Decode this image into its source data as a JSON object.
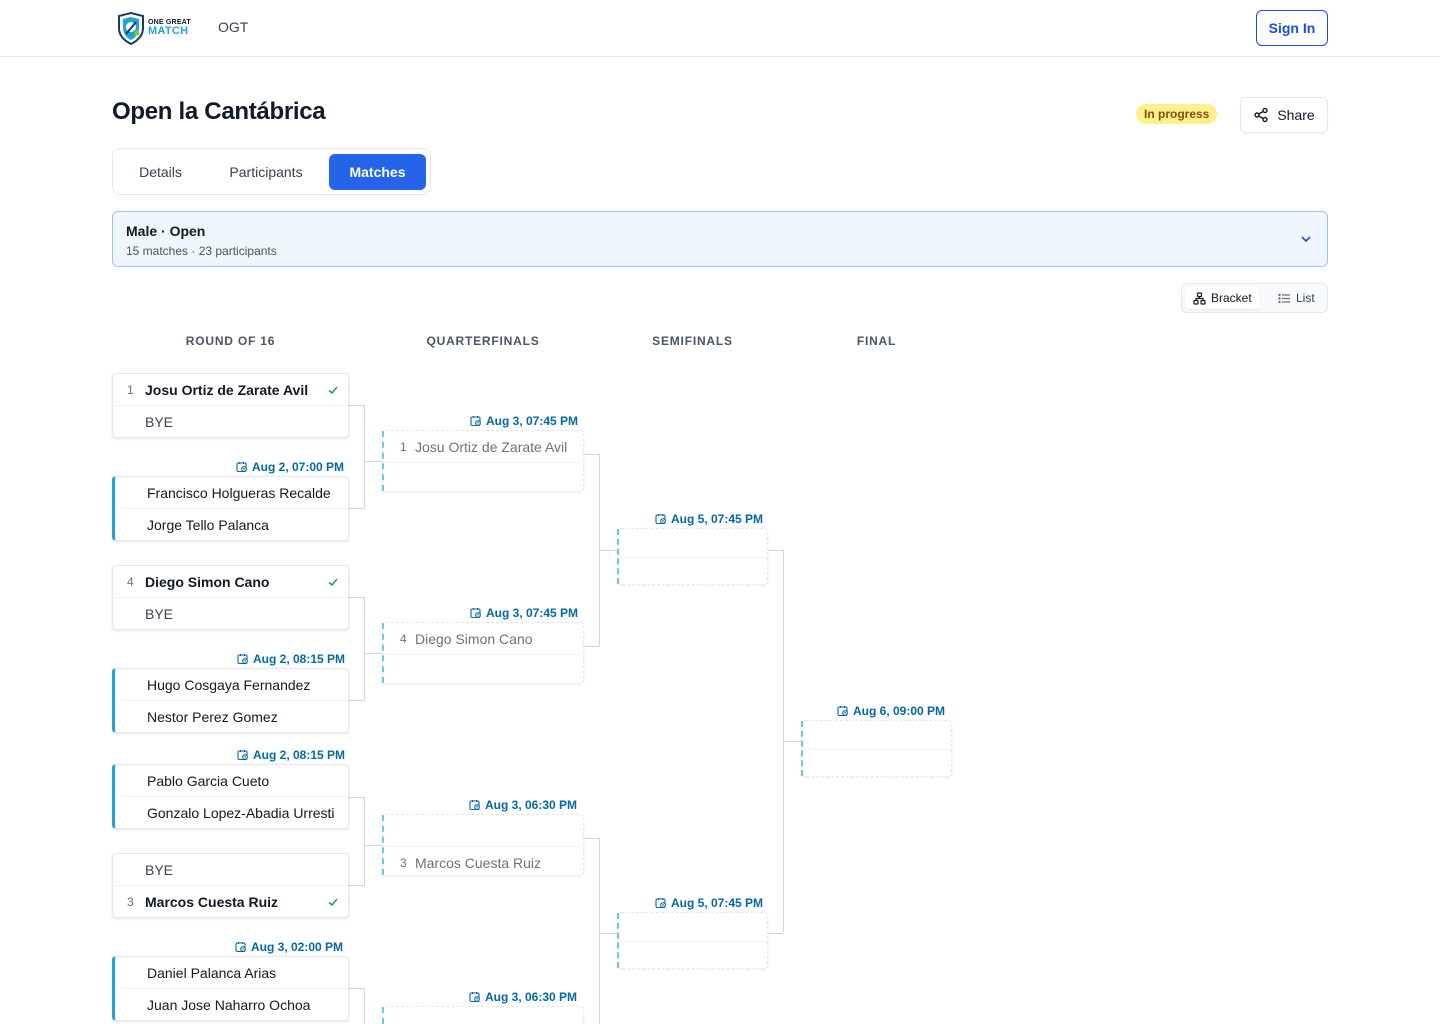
{
  "header": {
    "logo_line1": "ONE GREAT",
    "logo_line2": "MATCH",
    "nav_item": "OGT",
    "signin_label": "Sign In"
  },
  "tournament": {
    "title": "Open la Cantábrica",
    "status": "In progress",
    "share_label": "Share"
  },
  "tabs": [
    {
      "label": "Details",
      "active": false
    },
    {
      "label": "Participants",
      "active": false
    },
    {
      "label": "Matches",
      "active": true
    }
  ],
  "category": {
    "title": "Male · Open",
    "subtitle": "15 matches · 23 participants"
  },
  "view_toggle": {
    "bracket_label": "Bracket",
    "list_label": "List",
    "selected": "Bracket"
  },
  "rounds": [
    "ROUND OF 16",
    "QUARTERFINALS",
    "SEMIFINALS",
    "FINAL"
  ],
  "r16": [
    {
      "date": "",
      "p1_seed": "1",
      "p1": "Josu Ortiz de Zarate Avil",
      "p2_seed": "",
      "p2": "BYE",
      "winner": 1
    },
    {
      "date": "Aug 2, 07:00 PM",
      "p1_seed": "",
      "p1": "Francisco Holgueras Recalde",
      "p2_seed": "",
      "p2": "Jorge Tello Palanca",
      "winner": 0
    },
    {
      "date": "",
      "p1_seed": "4",
      "p1": "Diego Simon Cano",
      "p2_seed": "",
      "p2": "BYE",
      "winner": 1
    },
    {
      "date": "Aug 2, 08:15 PM",
      "p1_seed": "",
      "p1": "Hugo Cosgaya Fernandez",
      "p2_seed": "",
      "p2": "Nestor Perez Gomez",
      "winner": 0
    },
    {
      "date": "Aug 2, 08:15 PM",
      "p1_seed": "",
      "p1": "Pablo Garcia Cueto",
      "p2_seed": "",
      "p2": "Gonzalo Lopez-Abadia Urresti",
      "winner": 0
    },
    {
      "date": "",
      "p1_seed": "",
      "p1": "BYE",
      "p2_seed": "3",
      "p2": "Marcos Cuesta Ruiz",
      "winner": 2
    },
    {
      "date": "Aug 3, 02:00 PM",
      "p1_seed": "",
      "p1": "Daniel Palanca Arias",
      "p2_seed": "",
      "p2": "Juan Jose Naharro Ochoa",
      "winner": 0
    }
  ],
  "qf": [
    {
      "date": "Aug 3, 07:45 PM",
      "p1_seed": "1",
      "p1": "Josu Ortiz de Zarate Avil",
      "p2_seed": "",
      "p2": ""
    },
    {
      "date": "Aug 3, 07:45 PM",
      "p1_seed": "4",
      "p1": "Diego Simon Cano",
      "p2_seed": "",
      "p2": ""
    },
    {
      "date": "Aug 3, 06:30 PM",
      "p1_seed": "",
      "p1": "",
      "p2_seed": "3",
      "p2": "Marcos Cuesta Ruiz"
    },
    {
      "date": "Aug 3, 06:30 PM",
      "p1_seed": "",
      "p1": "",
      "p2_seed": "",
      "p2": ""
    }
  ],
  "sf": [
    {
      "date": "Aug 5, 07:45 PM"
    },
    {
      "date": "Aug 5, 07:45 PM"
    }
  ],
  "final": {
    "date": "Aug 6, 09:00 PM"
  },
  "colors": {
    "primary": "#2563eb",
    "accent": "#22a4d9",
    "schedule_text": "#0369a1",
    "winner_check": "#16a34a",
    "status_bg": "#fef08a"
  }
}
